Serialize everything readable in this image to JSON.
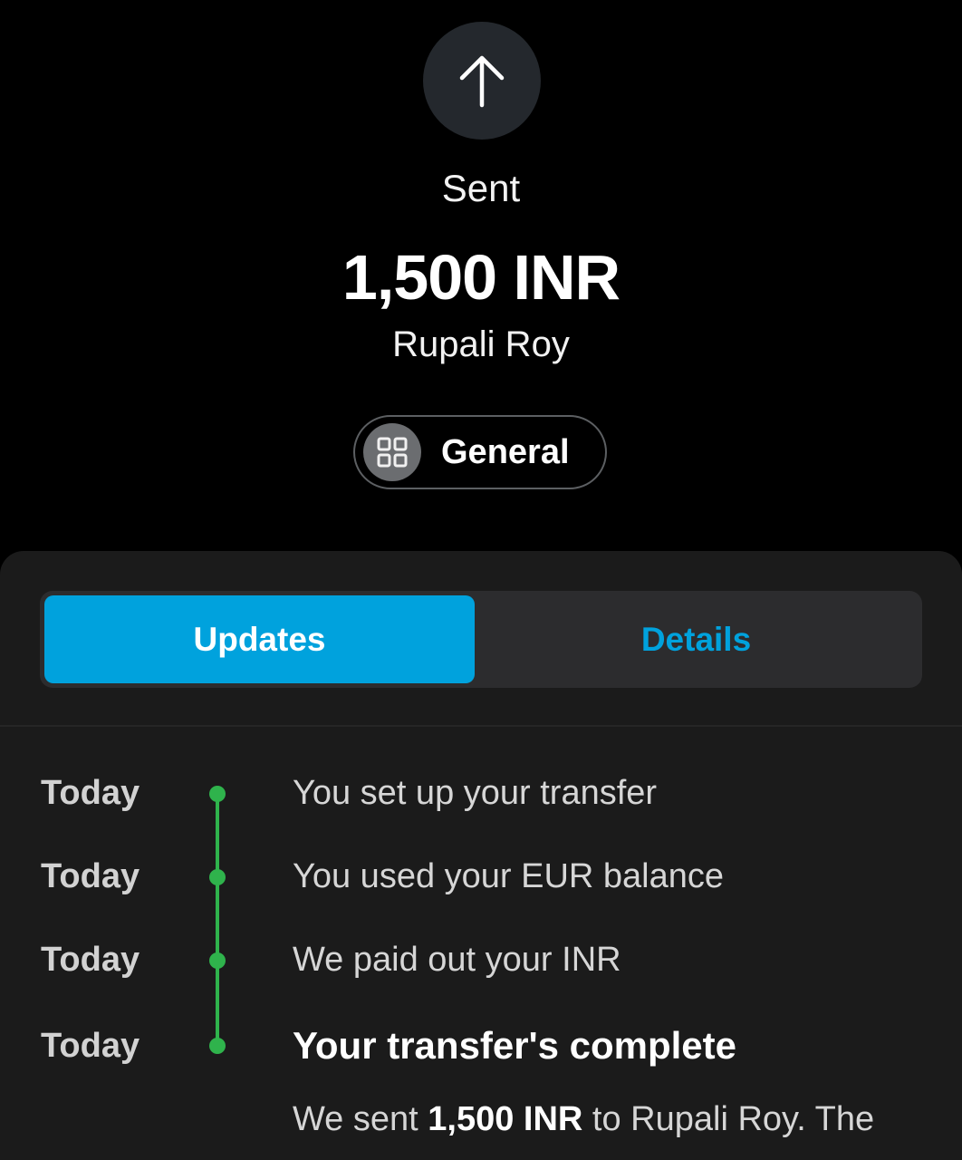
{
  "transaction": {
    "direction_icon": "arrow-up-icon",
    "status": "Sent",
    "amount": "1,500 INR",
    "recipient": "Rupali Roy",
    "category": {
      "icon": "grid-icon",
      "label": "General"
    }
  },
  "tabs": [
    {
      "label": "Updates",
      "active": true
    },
    {
      "label": "Details",
      "active": false
    }
  ],
  "timeline": [
    {
      "date": "Today",
      "text": "You set up your transfer"
    },
    {
      "date": "Today",
      "text": "You used your EUR balance"
    },
    {
      "date": "Today",
      "text": "We paid out your INR"
    },
    {
      "date": "Today",
      "text": "Your transfer's complete"
    }
  ],
  "completion_detail": {
    "prefix": "We sent ",
    "amount": "1,500 INR",
    "suffix": " to Rupali Roy. The"
  },
  "colors": {
    "accent": "#00a2dd",
    "timeline": "#2fb34c",
    "sheet": "#1b1b1b",
    "background": "#000000"
  }
}
